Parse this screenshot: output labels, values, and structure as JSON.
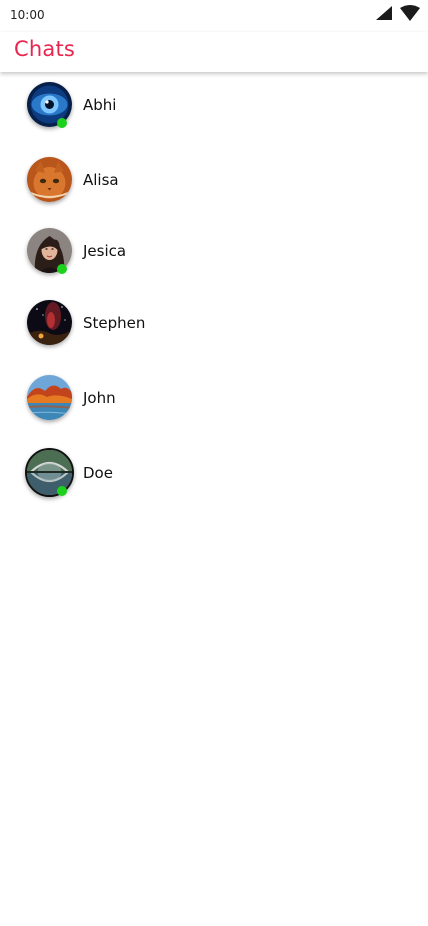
{
  "status_bar": {
    "time": "10:00"
  },
  "app_bar": {
    "title": "Chats",
    "title_color": "#E8254F"
  },
  "chats": [
    {
      "name": "Abhi",
      "avatar_icon": "eye-photo",
      "online": true
    },
    {
      "name": "Alisa",
      "avatar_icon": "cat-photo",
      "online": false
    },
    {
      "name": "Jesica",
      "avatar_icon": "woman-photo",
      "online": true
    },
    {
      "name": "Stephen",
      "avatar_icon": "night-sky-photo",
      "online": false
    },
    {
      "name": "John",
      "avatar_icon": "autumn-lake-photo",
      "online": false
    },
    {
      "name": "Doe",
      "avatar_icon": "bridge-reflection-photo",
      "online": true
    }
  ],
  "colors": {
    "online_indicator": "#1DD21D"
  }
}
